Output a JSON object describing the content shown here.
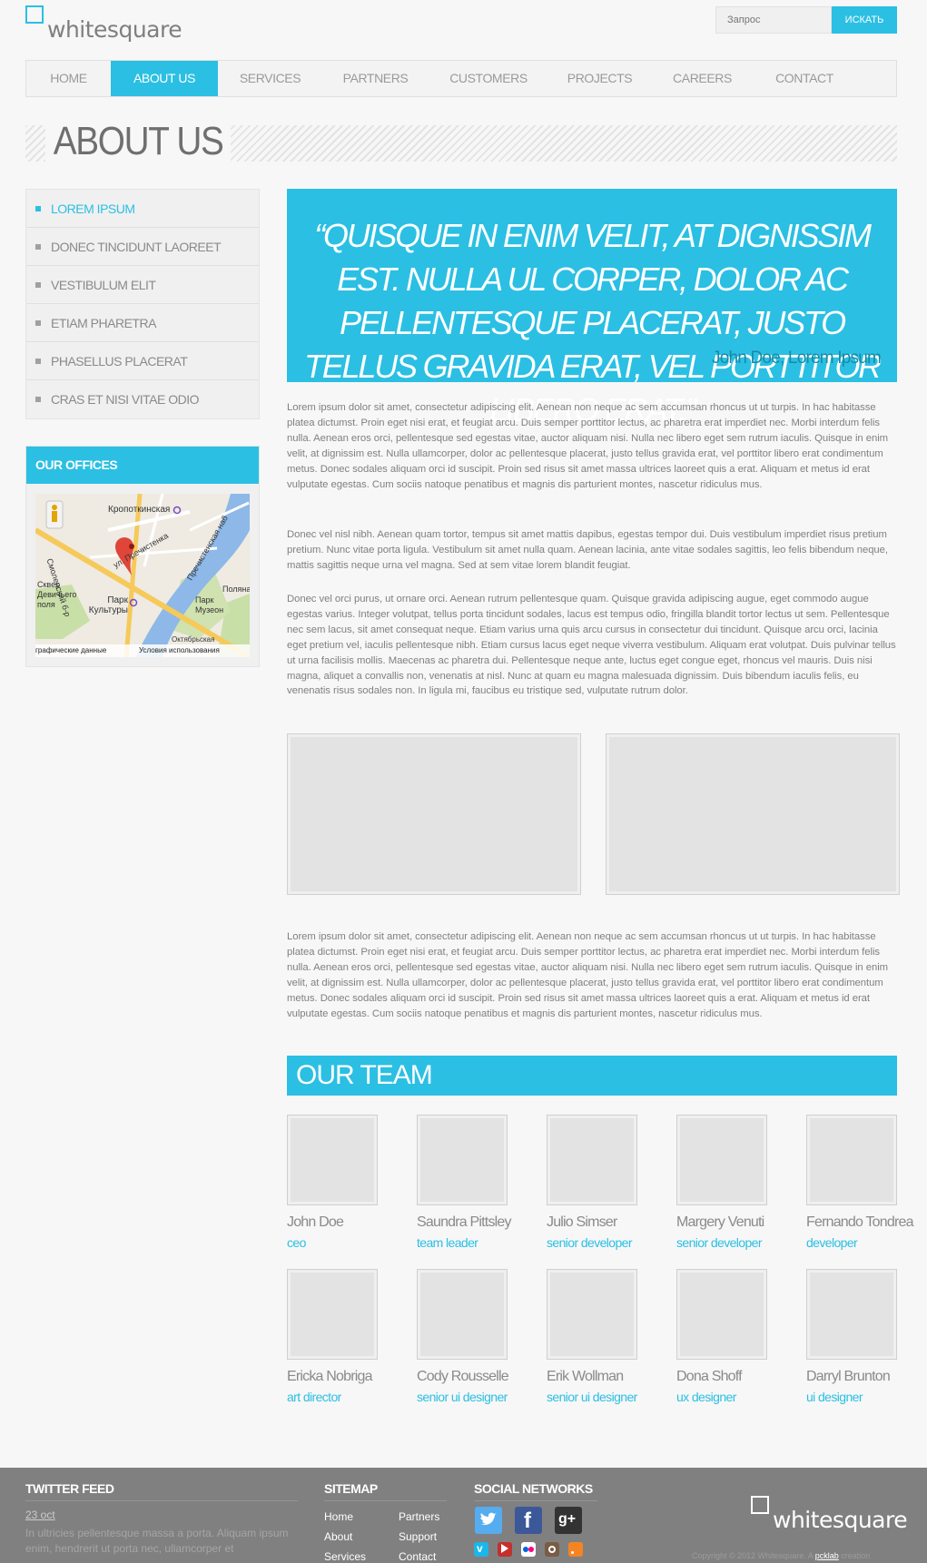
{
  "header": {
    "logo_text": "whitesquare",
    "search_placeholder": "Запрос",
    "search_button": "ИСКАТЬ"
  },
  "nav": {
    "items": [
      "Home",
      "About us",
      "Services",
      "Partners",
      "Customers",
      "Projects",
      "Careers",
      "Contact"
    ],
    "active": "About us"
  },
  "page_title": "ABOUT US",
  "sidebar": {
    "menu": [
      "Lorem ipsum",
      "Donec tincidunt laoreet",
      "Vestibulum elit",
      "Etiam pharetra",
      "Phasellus placerat",
      "Cras et nisi vitae odio"
    ],
    "offices_title": "OUR OFFICES",
    "map_labels": {
      "station": "Кропоткинская",
      "street1": "Смоленский б-р",
      "street2": "ул. Пречистенка",
      "street3": "Пречистенская наб",
      "park1": "Сквер Девичьего поля",
      "park2": "Парк Культуры",
      "park3": "Парк Музеон",
      "area": "Поляна",
      "oct": "Октябрьская",
      "footer1": "графические данные",
      "footer2": "Условия использования"
    }
  },
  "quote": {
    "text": "“Quisque in enim velit, at dignissim est. nulla ul corper, dolor ac pellentesque placerat, justo tellus gravida erat, vel porttitor libero erat.”",
    "author": "John Doe, Lorem Ipsum"
  },
  "paragraphs": [
    "Lorem ipsum dolor sit amet, consectetur adipiscing elit. Aenean non neque ac sem accumsan rhoncus ut ut turpis. In hac habitasse platea dictumst. Proin eget nisi erat, et feugiat arcu. Duis semper porttitor lectus, ac pharetra erat imperdiet nec. Morbi interdum felis nulla. Aenean eros orci, pellentesque sed egestas vitae, auctor aliquam nisi. Nulla nec libero eget sem rutrum iaculis. Quisque in enim velit, at dignissim est. Nulla ullamcorper, dolor ac pellentesque placerat, justo tellus gravida erat, vel porttitor libero erat condimentum metus. Donec sodales aliquam orci id suscipit. Proin sed risus sit amet massa ultrices laoreet quis a erat. Aliquam et metus id erat vulputate egestas. Cum sociis natoque penatibus et magnis dis parturient montes, nascetur ridiculus mus.",
    "Donec vel nisl nibh. Aenean quam tortor, tempus sit amet mattis dapibus, egestas tempor dui. Duis vestibulum imperdiet risus pretium pretium. Nunc vitae porta ligula. Vestibulum sit amet nulla quam. Aenean lacinia, ante vitae sodales sagittis, leo felis bibendum neque, mattis sagittis neque urna vel magna. Sed at sem vitae lorem blandit feugiat.",
    "Donec vel orci purus, ut ornare orci. Aenean rutrum pellentesque quam. Quisque gravida adipiscing augue, eget commodo augue egestas varius. Integer volutpat, tellus porta tincidunt sodales, lacus est tempus odio, fringilla blandit tortor lectus ut sem. Pellentesque nec sem lacus, sit amet consequat neque. Etiam varius urna quis arcu cursus in consectetur dui tincidunt. Quisque arcu orci, lacinia eget pretium vel, iaculis pellentesque nibh. Etiam cursus lacus eget neque viverra vestibulum. Aliquam erat volutpat. Duis pulvinar tellus ut urna facilisis mollis. Maecenas ac pharetra dui. Pellentesque neque ante, luctus eget congue eget, rhoncus vel mauris. Duis nisi magna, aliquet a convallis non, venenatis at nisl. Nunc at quam eu magna malesuada dignissim. Duis bibendum iaculis felis, eu venenatis risus sodales non. In ligula mi, faucibus eu tristique sed, vulputate rutrum dolor.",
    "Lorem ipsum dolor sit amet, consectetur adipiscing elit. Aenean non neque ac sem accumsan rhoncus ut ut turpis. In hac habitasse platea dictumst. Proin eget nisi erat, et feugiat arcu. Duis semper porttitor lectus, ac pharetra erat imperdiet nec. Morbi interdum felis nulla. Aenean eros orci, pellentesque sed egestas vitae, auctor aliquam nisi. Nulla nec libero eget sem rutrum iaculis. Quisque in enim velit, at dignissim est. Nulla ullamcorper, dolor ac pellentesque placerat, justo tellus gravida erat, vel porttitor libero erat condimentum metus. Donec sodales aliquam orci id suscipit. Proin sed risus sit amet massa ultrices laoreet quis a erat. Aliquam et metus id erat vulputate egestas. Cum sociis natoque penatibus et magnis dis parturient montes, nascetur ridiculus mus."
  ],
  "team": {
    "title": "OUR TEAM",
    "members": [
      {
        "name": "John Doe",
        "role": "ceo"
      },
      {
        "name": "Saundra Pittsley",
        "role": "team leader"
      },
      {
        "name": "Julio Simser",
        "role": "senior developer"
      },
      {
        "name": "Margery Venuti",
        "role": "senior developer"
      },
      {
        "name": "Fernando Tondrea",
        "role": "developer"
      },
      {
        "name": "Ericka Nobriga",
        "role": "art director"
      },
      {
        "name": "Cody Rousselle",
        "role": "senior ui designer"
      },
      {
        "name": "Erik Wollman",
        "role": "senior ui designer"
      },
      {
        "name": "Dona Shoff",
        "role": "ux designer"
      },
      {
        "name": "Darryl Brunton",
        "role": "ui designer"
      }
    ]
  },
  "footer": {
    "twitter_title": "TWITTER FEED",
    "twitter_date": "23 oct",
    "twitter_text": "In ultricies pellentesque massa a porta. Aliquam ipsum enim, hendrerit ut porta nec, ullamcorper et",
    "sitemap_title": "SITEMAP",
    "sitemap_col1": [
      "Home",
      "About",
      "Services"
    ],
    "sitemap_col2": [
      "Partners",
      "Support",
      "Contact"
    ],
    "social_title": "SOCIAL NETWORKS",
    "logo_text": "whitesquare",
    "copyright_prefix": "Copyright © 2012 Whitesquare. A",
    "copyright_link": "pcklab",
    "copyright_suffix": "creation"
  },
  "colors": {
    "accent": "#2bbfe3",
    "footer": "#808080",
    "background": "#f7f7f7"
  }
}
